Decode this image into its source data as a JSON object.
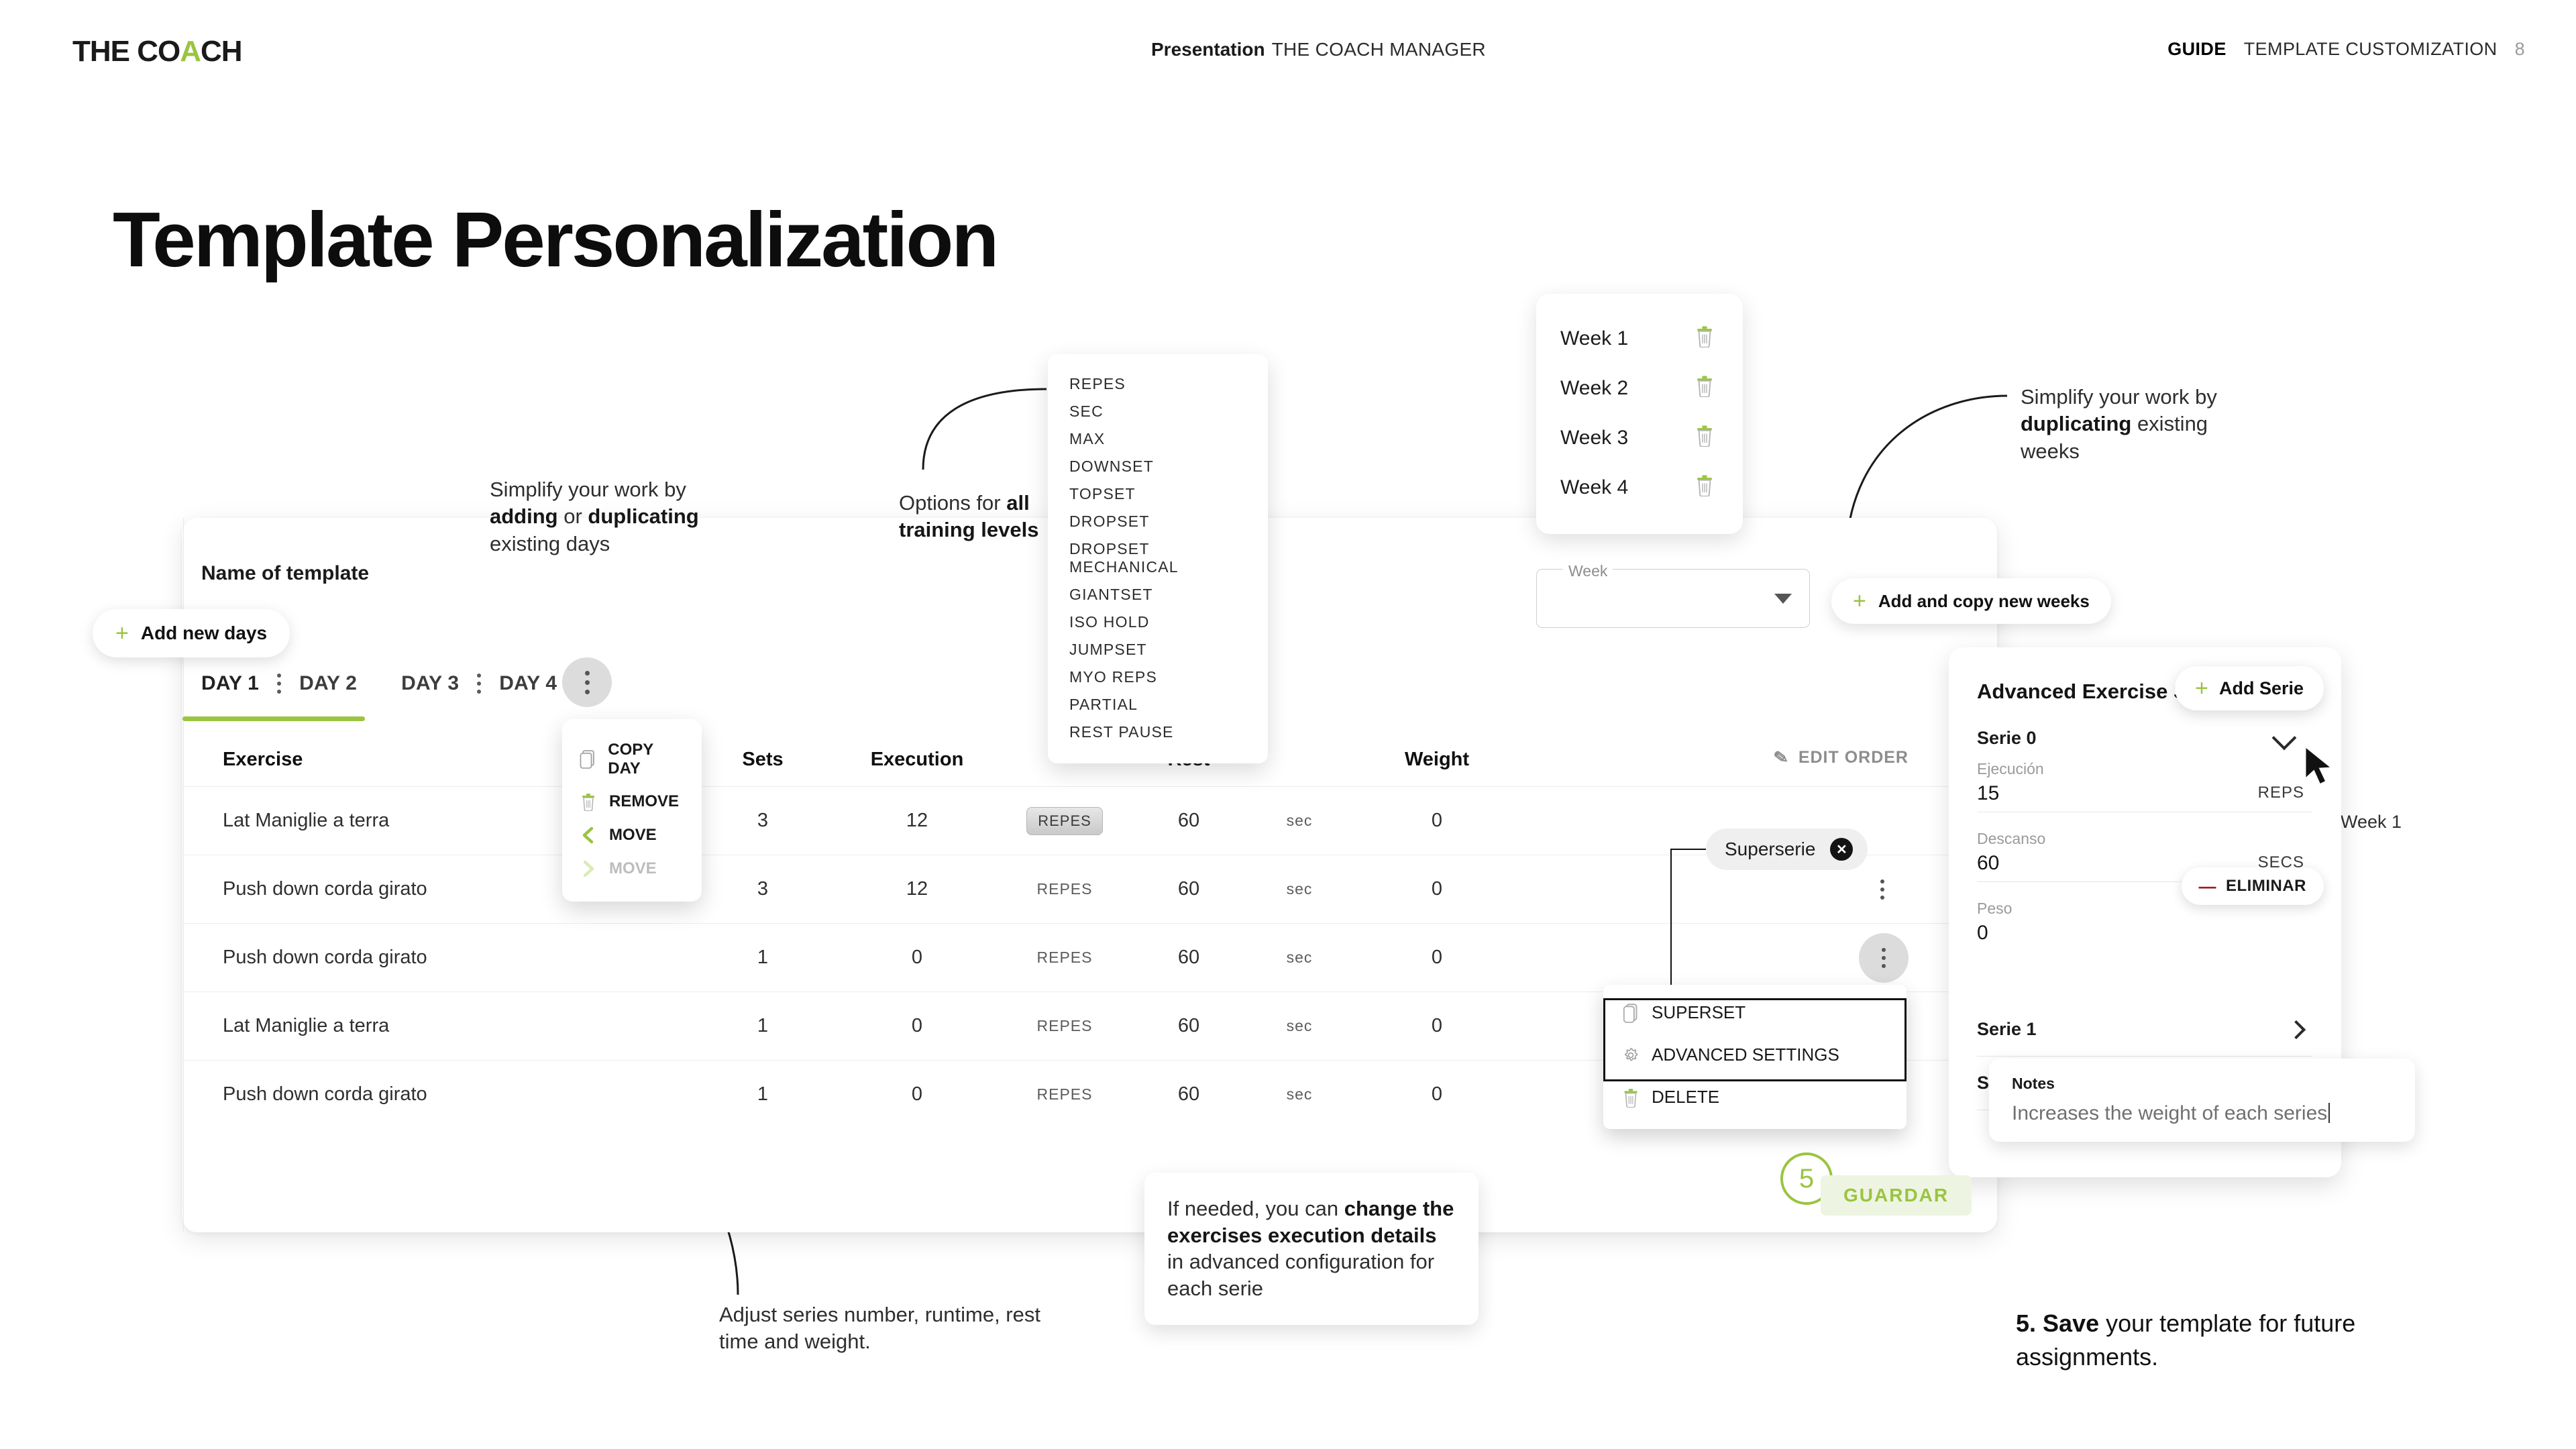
{
  "header": {
    "logo_the": "THE CO",
    "logo_a": "A",
    "logo_ch": "CH",
    "center_bold": "Presentation",
    "center_normal": "THE COACH MANAGER",
    "right_bold": "GUIDE",
    "right_normal": "TEMPLATE CUSTOMIZATION",
    "page_number": "8"
  },
  "page_title": "Template Personalization",
  "app": {
    "template_name_label": "Name of template",
    "add_new_days": "Add new days",
    "tabs": [
      {
        "label": "DAY 1",
        "active": true
      },
      {
        "label": "DAY 2",
        "active": false
      },
      {
        "label": "DAY 3",
        "active": false
      },
      {
        "label": "DAY 4",
        "active": false
      }
    ],
    "edit_order": "EDIT ORDER",
    "week_label": "Week 1",
    "superserie_chip": "Superserie",
    "table": {
      "columns": [
        "Exercise",
        "Sets",
        "Execution",
        "Rest",
        "Weight"
      ],
      "rows": [
        {
          "exercise": "Lat Maniglie a terra",
          "sets": "3",
          "execution": "12",
          "exec_unit": "REPES",
          "rest": "60",
          "rest_unit": "sec",
          "weight": "0"
        },
        {
          "exercise": "Push down corda girato",
          "sets": "3",
          "execution": "12",
          "exec_unit": "REPES",
          "rest": "60",
          "rest_unit": "sec",
          "weight": "0"
        },
        {
          "exercise": "Push down corda girato",
          "sets": "1",
          "execution": "0",
          "exec_unit": "REPES",
          "rest": "60",
          "rest_unit": "sec",
          "weight": "0"
        },
        {
          "exercise": "Lat Maniglie a terra",
          "sets": "1",
          "execution": "0",
          "exec_unit": "REPES",
          "rest": "60",
          "rest_unit": "sec",
          "weight": "0"
        },
        {
          "exercise": "Push down corda girato",
          "sets": "1",
          "execution": "0",
          "exec_unit": "REPES",
          "rest": "60",
          "rest_unit": "sec",
          "weight": "0"
        }
      ]
    }
  },
  "day_menu": {
    "items": [
      {
        "label": "COPY DAY",
        "icon": "copy-icon",
        "disabled": false
      },
      {
        "label": "REMOVE",
        "icon": "trash-icon",
        "disabled": false
      },
      {
        "label": "MOVE",
        "icon": "chevron-left-icon",
        "disabled": false
      },
      {
        "label": "MOVE",
        "icon": "chevron-right-icon",
        "disabled": true
      }
    ]
  },
  "row_menu": {
    "items": [
      {
        "label": "SUPERSET",
        "icon": "copy-icon",
        "highlighted": false
      },
      {
        "label": "ADVANCED SETTINGS",
        "icon": "gear-icon",
        "highlighted": true
      },
      {
        "label": "DELETE",
        "icon": "trash-icon",
        "highlighted": false
      }
    ]
  },
  "execution_options": [
    "REPES",
    "SEC",
    "MAX",
    "DOWNSET",
    "TOPSET",
    "DROPSET",
    "DROPSET MECHANICAL",
    "GIANTSET",
    "ISO HOLD",
    "JUMPSET",
    "MYO REPS",
    "PARTIAL",
    "REST PAUSE"
  ],
  "weeks_panel": {
    "weeks": [
      "Week 1",
      "Week 2",
      "Week 3",
      "Week 4"
    ],
    "select_label": "Week",
    "select_value": "",
    "add_copy_button": "Add and copy new weeks"
  },
  "advanced": {
    "title": "Advanced Exercise Settings",
    "add_serie": "Add Serie",
    "serie_open_label": "Serie 0",
    "fields": [
      {
        "label": "Ejecución",
        "value": "15",
        "suffix": "REPS"
      },
      {
        "label": "Descanso",
        "value": "60",
        "suffix": "SECS"
      },
      {
        "label": "Peso",
        "value": "0",
        "suffix": ""
      }
    ],
    "eliminar": "ELIMINAR",
    "collapsed_series": [
      "Serie 1",
      "Serie 2"
    ]
  },
  "notes": {
    "label": "Notes",
    "value": "Increases the weight of each series"
  },
  "save": {
    "step_number": "5",
    "button_label": "GUARDAR"
  },
  "annotations": {
    "days": {
      "line1": "Simplify your work by ",
      "bold": "adding",
      "mid": " or ",
      "bold2": "duplicating",
      "line3": " existing days"
    },
    "levels": {
      "line1": "Options for ",
      "bold": "all training levels"
    },
    "weeks": {
      "line1": "Simplify your work by ",
      "bold": "duplicating",
      "line3": " existing weeks"
    },
    "series": "Adjust series number, runtime, rest time and weight.",
    "callout": {
      "p1": "If needed, you can ",
      "b1": "change the exercises execution details",
      "p2": " in advanced configuration for each serie"
    },
    "final": {
      "num": "5. ",
      "bold": "Save",
      "rest": " your template for future assignments."
    }
  },
  "colors": {
    "accent_green": "#9ac441",
    "text_dark": "#1a1a1a",
    "muted": "#8d8d8d",
    "delete_red": "#a01b1b"
  }
}
